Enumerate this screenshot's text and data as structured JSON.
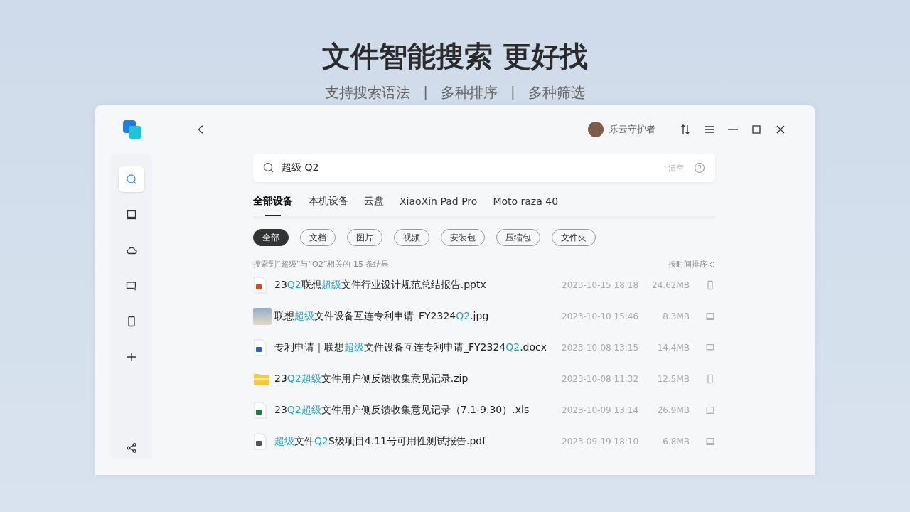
{
  "headline": {
    "title": "文件智能搜索 更好找",
    "subtitle": [
      "支持搜索语法",
      "多种排序",
      "多种筛选"
    ],
    "separator": "|"
  },
  "window": {
    "user": "乐云守护者"
  },
  "sidebar": {
    "items": [
      {
        "kind": "search",
        "selected": true
      },
      {
        "kind": "laptop",
        "selected": false
      },
      {
        "kind": "cloud",
        "selected": false
      },
      {
        "kind": "tablet",
        "selected": false
      },
      {
        "kind": "phone",
        "selected": false
      },
      {
        "kind": "add",
        "selected": false
      }
    ]
  },
  "search": {
    "value": "超级 Q2",
    "clear": "清空"
  },
  "tabs": [
    {
      "label": "全部设备",
      "selected": true
    },
    {
      "label": "本机设备",
      "selected": false
    },
    {
      "label": "云盘",
      "selected": false
    },
    {
      "label": "XiaoXin Pad Pro",
      "selected": false
    },
    {
      "label": "Moto raza 40",
      "selected": false
    }
  ],
  "filters": [
    {
      "label": "全部",
      "selected": true
    },
    {
      "label": "文档",
      "selected": false
    },
    {
      "label": "图片",
      "selected": false
    },
    {
      "label": "视频",
      "selected": false
    },
    {
      "label": "安装包",
      "selected": false
    },
    {
      "label": "压缩包",
      "selected": false
    },
    {
      "label": "文件夹",
      "selected": false
    }
  ],
  "summary": "搜索到“超级”与“Q2”相关的 15 条结果",
  "sort": "按时间排序",
  "files": [
    {
      "kind": "pptx",
      "device": {
        "kind": "phone"
      },
      "date": "2023-10-15 18:18",
      "size": "24.62MB",
      "parts": [
        {
          "text": "23",
          "highlight": false
        },
        {
          "text": "Q2",
          "highlight": true
        },
        {
          "text": "联想",
          "highlight": false
        },
        {
          "text": "超级",
          "highlight": true
        },
        {
          "text": "文件行业设计规范总结报告.pptx",
          "highlight": false
        }
      ]
    },
    {
      "kind": "jpg",
      "device": {
        "kind": "laptop"
      },
      "date": "2023-10-10 15:46",
      "size": "8.3MB",
      "parts": [
        {
          "text": "联想",
          "highlight": false
        },
        {
          "text": "超级",
          "highlight": true
        },
        {
          "text": "文件设备互连专利申请_FY2324",
          "highlight": false
        },
        {
          "text": "Q2",
          "highlight": true
        },
        {
          "text": ".jpg",
          "highlight": false
        }
      ]
    },
    {
      "kind": "docx",
      "device": {
        "kind": "laptop"
      },
      "date": "2023-10-08 13:15",
      "size": "14.4MB",
      "parts": [
        {
          "text": "专利申请｜联想",
          "highlight": false
        },
        {
          "text": "超级",
          "highlight": true
        },
        {
          "text": "文件设备互连专利申请_FY2324",
          "highlight": false
        },
        {
          "text": "Q2",
          "highlight": true
        },
        {
          "text": ".docx",
          "highlight": false
        }
      ]
    },
    {
      "kind": "zip",
      "device": {
        "kind": "phone"
      },
      "date": "2023-10-08 11:32",
      "size": "12.5MB",
      "parts": [
        {
          "text": "23",
          "highlight": false
        },
        {
          "text": "Q2",
          "highlight": true
        },
        {
          "text": "超级",
          "highlight": true
        },
        {
          "text": "文件用户侧反馈收集意见记录.zip",
          "highlight": false
        }
      ]
    },
    {
      "kind": "xls",
      "device": {
        "kind": "laptop"
      },
      "date": "2023-10-09 13:14",
      "size": "26.9MB",
      "parts": [
        {
          "text": "23",
          "highlight": false
        },
        {
          "text": "Q2",
          "highlight": true
        },
        {
          "text": "超级",
          "highlight": true
        },
        {
          "text": "文件用户侧反馈收集意见记录（7.1-9.30）.xls",
          "highlight": false
        }
      ]
    },
    {
      "kind": "pdf",
      "device": {
        "kind": "laptop"
      },
      "date": "2023-09-19 18:10",
      "size": "6.8MB",
      "parts": [
        {
          "text": "超级",
          "highlight": true
        },
        {
          "text": "文件",
          "highlight": false
        },
        {
          "text": "Q2",
          "highlight": true
        },
        {
          "text": "S级项目4.11号可用性测试报告.pdf",
          "highlight": false
        }
      ]
    }
  ]
}
